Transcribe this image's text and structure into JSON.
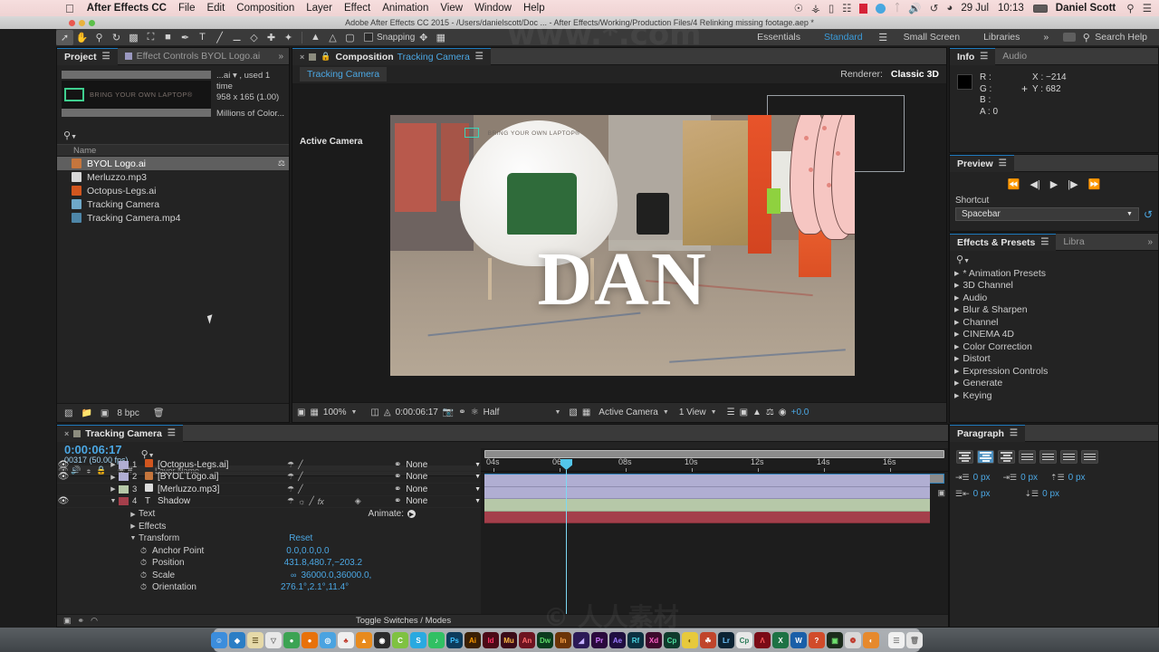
{
  "menubar": {
    "apple_icon": "apple-icon",
    "app_name": "After Effects CC",
    "items": [
      "File",
      "Edit",
      "Composition",
      "Layer",
      "Effect",
      "Animation",
      "View",
      "Window",
      "Help"
    ],
    "status_icons": [
      "dropbox-icon",
      "vpn-icon",
      "display-icon",
      "grid-icon",
      "recording-icon",
      "sync-icon",
      "bluetooth-icon",
      "volume-icon",
      "timemachine-icon",
      "wifi-icon"
    ],
    "date": "29 Jul",
    "time": "10:13",
    "battery_icon": "battery-icon",
    "user": "Daniel Scott",
    "search_icon": "search-icon",
    "notification_icon": "notification-icon"
  },
  "titlebar": {
    "title": "Adobe After Effects CC 2015 - /Users/danielscott/Doc ... - After Effects/Working/Production Files/4 Relinking missing footage.aep *",
    "close_color": "#e8584e",
    "min_color": "#e9b23c",
    "max_color": "#5cc04a"
  },
  "toolbar": {
    "tools": [
      "selection-tool",
      "hand-tool",
      "zoom-tool",
      "rotation-tool",
      "camera-tool",
      "pan-behind-tool",
      "shape-tool",
      "pen-tool",
      "type-tool",
      "brush-tool",
      "clone-stamp-tool",
      "eraser-tool",
      "roto-brush-tool",
      "puppet-pin-tool"
    ],
    "rig_tools": [
      "unified-camera-icon",
      "orbit-camera-icon",
      "mask-icon"
    ],
    "snapping_label": "Snapping",
    "snap_icons": [
      "snap-icon",
      "grid-snap-icon"
    ],
    "workspaces": [
      "Essentials",
      "Standard",
      "Small Screen",
      "Libraries"
    ],
    "workspace_selected": "Standard",
    "overflow": "»",
    "search_help": "Search Help",
    "search_icon": "search-icon",
    "workspace_menu_icon": "workspace-menu-icon"
  },
  "project": {
    "tabs": [
      {
        "label": "Project",
        "active": true
      },
      {
        "label": "Effect Controls BYOL Logo.ai",
        "active": false
      }
    ],
    "overflow": "»",
    "thumbnail_text": "BRING YOUR OWN LAPTOP®",
    "info_line1": "...ai ▾ , used 1 time",
    "info_line2": "958 x 165 (1.00)",
    "info_line3": "Millions of Color...",
    "search_icon": "search-icon",
    "column_name": "Name",
    "items": [
      {
        "name": "BYOL Logo.ai",
        "icon": "illustrator-file-icon",
        "color": "#c5763d",
        "selected": true,
        "shared": true
      },
      {
        "name": "Merluzzo.mp3",
        "icon": "audio-file-icon",
        "color": "#d8d8d8",
        "selected": false,
        "shared": false
      },
      {
        "name": "Octopus-Legs.ai",
        "icon": "illustrator-file-icon",
        "color": "#d1561f",
        "selected": false,
        "shared": false
      },
      {
        "name": "Tracking Camera",
        "icon": "composition-icon",
        "color": "#6fa8c8",
        "selected": false,
        "shared": false
      },
      {
        "name": "Tracking Camera.mp4",
        "icon": "video-file-icon",
        "color": "#4e86a8",
        "selected": false,
        "shared": false
      }
    ],
    "footer": {
      "bit_depth": "8 bpc",
      "icons": [
        "interpret-footage-icon",
        "new-folder-icon",
        "new-composition-icon",
        "delete-icon"
      ]
    }
  },
  "composition": {
    "tab_close": "×",
    "tab_lock_icon": "lock-icon",
    "tab_label": "Composition",
    "tab_name": "Tracking Camera",
    "menu_icon": "panel-menu-icon",
    "comp_name_button": "Tracking Camera",
    "renderer_label": "Renderer:",
    "renderer_value": "Classic 3D",
    "active_camera_label": "Active Camera",
    "canvas_text": "DAN",
    "pod_text": "BRING YOUR OWN LAPTOP®",
    "bottombar": {
      "zoom": "100%",
      "timecode": "0:00:06:17",
      "resolution": "Half",
      "view_camera": "Active Camera",
      "views": "1 View",
      "exposure": "+0.0",
      "icons": [
        "always-preview-icon",
        "toggle-transparency-icon",
        "region-of-interest-icon",
        "toggle-mask-icon",
        "snapshot-icon",
        "channel-icon",
        "show-channel-icon",
        "grid-guides-icon",
        "toggle-guides-icon",
        "3d-view-icon",
        "pixel-aspect-icon",
        "fast-preview-icon",
        "timeline-icon",
        "comp-flowchart-icon",
        "exposure-icon"
      ]
    }
  },
  "info": {
    "tabs": [
      {
        "label": "Info",
        "active": true
      },
      {
        "label": "Audio",
        "active": false
      }
    ],
    "menu_icon": "panel-menu-icon",
    "channels": [
      {
        "label": "R :",
        "value": ""
      },
      {
        "label": "G :",
        "value": ""
      },
      {
        "label": "B :",
        "value": ""
      },
      {
        "label": "A :",
        "value": "0"
      }
    ],
    "x_label": "X : −214",
    "y_label": "Y : 682"
  },
  "preview": {
    "title": "Preview",
    "menu_icon": "panel-menu-icon",
    "buttons": [
      "first-frame-icon",
      "previous-frame-icon",
      "play-icon",
      "next-frame-icon",
      "last-frame-icon"
    ],
    "shortcut_label": "Shortcut",
    "shortcut_value": "Spacebar",
    "reset_icon": "reset-icon"
  },
  "effects": {
    "tabs": [
      {
        "label": "Effects & Presets",
        "active": true
      },
      {
        "label": "Libra",
        "active": false
      }
    ],
    "menu_icon": "panel-menu-icon",
    "overflow": "»",
    "search_icon": "search-icon",
    "categories": [
      "* Animation Presets",
      "3D Channel",
      "Audio",
      "Blur & Sharpen",
      "Channel",
      "CINEMA 4D",
      "Color Correction",
      "Distort",
      "Expression Controls",
      "Generate",
      "Keying"
    ]
  },
  "paragraph": {
    "title": "Paragraph",
    "menu_icon": "panel-menu-icon",
    "align_buttons": [
      "align-left-icon",
      "align-center-icon",
      "align-right-icon",
      "justify-last-left-icon",
      "justify-last-center-icon",
      "justify-last-right-icon",
      "justify-all-icon"
    ],
    "active_align_index": 1,
    "spacing": [
      {
        "icon": "indent-left-icon",
        "value": "0 px"
      },
      {
        "icon": "indent-right-icon",
        "value": "0 px"
      },
      {
        "icon": "space-before-icon",
        "value": "0 px"
      },
      {
        "icon": "first-line-indent-icon",
        "value": "0 px"
      },
      {
        "icon": "space-after-icon",
        "value": "0 px"
      }
    ]
  },
  "timeline": {
    "tab_close": "×",
    "tab_name": "Tracking Camera",
    "menu_icon": "panel-menu-icon",
    "timecode": "0:00:06:17",
    "frames": "00317 (50.00 fps)",
    "search_icon": "search-icon",
    "header_icons": [
      "composition-mini-flowchart-icon",
      "draft-3d-icon",
      "hide-shy-layers-icon",
      "frame-blending-icon",
      "motion-blur-icon",
      "graph-editor-icon"
    ],
    "columns": {
      "eye": "video-switch-icon",
      "audio": "audio-switch-icon",
      "solo": "solo-switch-icon",
      "lock": "lock-switch-icon",
      "label": "label-icon",
      "num": "#",
      "name": "Layer Name",
      "switches": [
        "shy-icon",
        "collapse-icon",
        "quality-icon",
        "fx-icon",
        "frame-blend-icon",
        "motion-blur-icon",
        "adjustment-icon",
        "3d-layer-icon"
      ],
      "parent": "Parent"
    },
    "layers": [
      {
        "num": "1",
        "name": "[Octopus-Legs.ai]",
        "color": "#b0aed2",
        "label_color": "#b0aed2",
        "parent": "None",
        "visible": true,
        "icon": "illustrator-layer-icon",
        "icon_color": "#d1561f",
        "expanded": false,
        "has_fx": false
      },
      {
        "num": "2",
        "name": "[BYOL Logo.ai]",
        "color": "#b0aed2",
        "label_color": "#b0aed2",
        "parent": "None",
        "visible": true,
        "icon": "illustrator-layer-icon",
        "icon_color": "#c5763d",
        "expanded": false,
        "has_fx": false
      },
      {
        "num": "3",
        "name": "[Merluzzo.mp3]",
        "color": "#b6c8a8",
        "label_color": "#b6c8a8",
        "parent": "None",
        "visible": false,
        "icon": "audio-layer-icon",
        "icon_color": "#dcdcdc",
        "expanded": false,
        "has_fx": false
      },
      {
        "num": "4",
        "name": "Shadow",
        "color": "#a43f4b",
        "label_color": "#a43f4b",
        "parent": "None",
        "visible": true,
        "icon": "text-layer-icon",
        "icon_color": "#d8d8d8",
        "expanded": true,
        "has_fx": true
      }
    ],
    "animate_label": "Animate:",
    "properties": [
      {
        "name": "Text",
        "value": "",
        "expanded": false,
        "indent": 1
      },
      {
        "name": "Effects",
        "value": "",
        "expanded": false,
        "indent": 1
      },
      {
        "name": "Transform",
        "value": "Reset",
        "expanded": true,
        "indent": 1
      },
      {
        "name": "Anchor Point",
        "value": "0.0,0.0,0.0",
        "expanded": false,
        "indent": 2,
        "stopwatch": true
      },
      {
        "name": "Position",
        "value": "431.8,480.7,−203.2",
        "expanded": false,
        "indent": 2,
        "stopwatch": true
      },
      {
        "name": "Scale",
        "value": "36000.0,36000.0,",
        "expanded": false,
        "indent": 2,
        "stopwatch": true,
        "link": true
      },
      {
        "name": "Orientation",
        "value": "276.1°,2.1°,11.4°",
        "expanded": false,
        "indent": 2,
        "stopwatch": true
      }
    ],
    "ruler_ticks": [
      "04s",
      "06s",
      "08s",
      "10s",
      "12s",
      "14s",
      "16s"
    ],
    "footer_label": "Toggle Switches / Modes",
    "footer_icons": [
      "toggle-switches-icon",
      "frame-render-icon",
      "graph-icon"
    ]
  },
  "dock": {
    "items": [
      {
        "name": "finder",
        "color": "#3c8ddc",
        "glyph": "☺"
      },
      {
        "name": "dropbox",
        "color": "#2b7ec5",
        "glyph": "◈"
      },
      {
        "name": "notes",
        "color": "#e6d9a8",
        "glyph": "☰"
      },
      {
        "name": "trash-app",
        "color": "#e8e8e8",
        "glyph": "▽"
      },
      {
        "name": "chrome",
        "color": "#3ca353",
        "glyph": "●"
      },
      {
        "name": "firefox",
        "color": "#e8710a",
        "glyph": "●"
      },
      {
        "name": "safari",
        "color": "#4aa3e0",
        "glyph": "◎"
      },
      {
        "name": "app-red",
        "color": "#e7e7e7",
        "glyph": "♣"
      },
      {
        "name": "vlc",
        "color": "#e88a1c",
        "glyph": "▲"
      },
      {
        "name": "obs",
        "color": "#2b2b2b",
        "glyph": "◉"
      },
      {
        "name": "c-app",
        "color": "#7fc241",
        "glyph": "C"
      },
      {
        "name": "skype",
        "color": "#2aa9e0",
        "glyph": "S"
      },
      {
        "name": "spotify",
        "color": "#31c063",
        "glyph": "♪"
      },
      {
        "name": "photoshop",
        "color": "#0d3c5c",
        "glyph": "Ps"
      },
      {
        "name": "illustrator",
        "color": "#3a1f04",
        "glyph": "Ai"
      },
      {
        "name": "indesign",
        "color": "#4b0a17",
        "glyph": "Id"
      },
      {
        "name": "muse",
        "color": "#3a0a18",
        "glyph": "Mu"
      },
      {
        "name": "animate",
        "color": "#6d1420",
        "glyph": "An"
      },
      {
        "name": "dreamweaver",
        "color": "#0b3b1d",
        "glyph": "Dw"
      },
      {
        "name": "incopy",
        "color": "#6b3408",
        "glyph": "In"
      },
      {
        "name": "aftereffects-purple",
        "color": "#2b1a56",
        "glyph": "◢"
      },
      {
        "name": "premiere",
        "color": "#2a0a3c",
        "glyph": "Pr"
      },
      {
        "name": "aftereffects",
        "color": "#1f0f3f",
        "glyph": "Ae"
      },
      {
        "name": "rush",
        "color": "#0b3040",
        "glyph": "Rf"
      },
      {
        "name": "xd",
        "color": "#3d0a2c",
        "glyph": "Xd"
      },
      {
        "name": "capture",
        "color": "#0f3a2c",
        "glyph": "Cp"
      },
      {
        "name": "color-app",
        "color": "#e7c93c",
        "glyph": "◐"
      },
      {
        "name": "food-app",
        "color": "#c0452b",
        "glyph": "☘"
      },
      {
        "name": "lightroom",
        "color": "#0c2333",
        "glyph": "Lr"
      },
      {
        "name": "capture2",
        "color": "#e8e8e8",
        "glyph": "Cp"
      },
      {
        "name": "acrobat",
        "color": "#7a0b16",
        "glyph": "Λ"
      },
      {
        "name": "excel",
        "color": "#1d7244",
        "glyph": "X"
      },
      {
        "name": "word",
        "color": "#1a5fa8",
        "glyph": "W"
      },
      {
        "name": "parallels",
        "color": "#d14b2a",
        "glyph": "?"
      },
      {
        "name": "terminal",
        "color": "#1c2b1c",
        "glyph": "▣"
      },
      {
        "name": "colorsync",
        "color": "#d8d8d8",
        "glyph": "❁"
      },
      {
        "name": "preview-app",
        "color": "#e6892c",
        "glyph": "◔"
      }
    ],
    "documents_icon": "documents-stack-icon",
    "trash_icon": "trash-icon"
  }
}
